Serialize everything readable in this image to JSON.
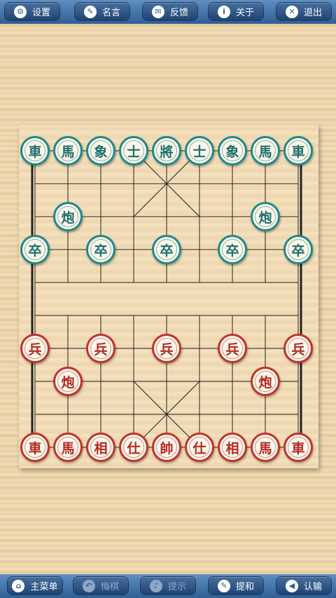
{
  "top_bar": {
    "buttons": [
      {
        "label": "设置",
        "icon": "gear-icon",
        "glyph": "⚙"
      },
      {
        "label": "名言",
        "icon": "speech-bubble-icon",
        "glyph": "✎"
      },
      {
        "label": "反馈",
        "icon": "mail-icon",
        "glyph": "✉"
      },
      {
        "label": "关于",
        "icon": "info-icon",
        "glyph": "i"
      },
      {
        "label": "退出",
        "icon": "close-icon",
        "glyph": "✕"
      }
    ]
  },
  "bottom_bar": {
    "buttons": [
      {
        "label": "主菜单",
        "icon": "home-icon",
        "glyph": "⌂",
        "enabled": true
      },
      {
        "label": "悔棋",
        "icon": "undo-icon",
        "glyph": "↶",
        "enabled": false
      },
      {
        "label": "提示",
        "icon": "bell-icon",
        "glyph": "♪",
        "enabled": false
      },
      {
        "label": "提和",
        "icon": "pen-icon",
        "glyph": "✎",
        "enabled": true
      },
      {
        "label": "认输",
        "icon": "flag-icon",
        "glyph": "◀",
        "enabled": true
      }
    ]
  },
  "board": {
    "files": 9,
    "ranks": 10,
    "pieces": [
      {
        "char": "車",
        "side": "black",
        "file": 0,
        "rank": 0
      },
      {
        "char": "馬",
        "side": "black",
        "file": 1,
        "rank": 0
      },
      {
        "char": "象",
        "side": "black",
        "file": 2,
        "rank": 0
      },
      {
        "char": "士",
        "side": "black",
        "file": 3,
        "rank": 0
      },
      {
        "char": "將",
        "side": "black",
        "file": 4,
        "rank": 0
      },
      {
        "char": "士",
        "side": "black",
        "file": 5,
        "rank": 0
      },
      {
        "char": "象",
        "side": "black",
        "file": 6,
        "rank": 0
      },
      {
        "char": "馬",
        "side": "black",
        "file": 7,
        "rank": 0
      },
      {
        "char": "車",
        "side": "black",
        "file": 8,
        "rank": 0
      },
      {
        "char": "炮",
        "side": "black",
        "file": 1,
        "rank": 2
      },
      {
        "char": "炮",
        "side": "black",
        "file": 7,
        "rank": 2
      },
      {
        "char": "卒",
        "side": "black",
        "file": 0,
        "rank": 3
      },
      {
        "char": "卒",
        "side": "black",
        "file": 2,
        "rank": 3
      },
      {
        "char": "卒",
        "side": "black",
        "file": 4,
        "rank": 3
      },
      {
        "char": "卒",
        "side": "black",
        "file": 6,
        "rank": 3
      },
      {
        "char": "卒",
        "side": "black",
        "file": 8,
        "rank": 3
      },
      {
        "char": "兵",
        "side": "red",
        "file": 0,
        "rank": 6
      },
      {
        "char": "兵",
        "side": "red",
        "file": 2,
        "rank": 6
      },
      {
        "char": "兵",
        "side": "red",
        "file": 4,
        "rank": 6
      },
      {
        "char": "兵",
        "side": "red",
        "file": 6,
        "rank": 6
      },
      {
        "char": "兵",
        "side": "red",
        "file": 8,
        "rank": 6
      },
      {
        "char": "炮",
        "side": "red",
        "file": 1,
        "rank": 7
      },
      {
        "char": "炮",
        "side": "red",
        "file": 7,
        "rank": 7
      },
      {
        "char": "車",
        "side": "red",
        "file": 0,
        "rank": 9
      },
      {
        "char": "馬",
        "side": "red",
        "file": 1,
        "rank": 9
      },
      {
        "char": "相",
        "side": "red",
        "file": 2,
        "rank": 9
      },
      {
        "char": "仕",
        "side": "red",
        "file": 3,
        "rank": 9
      },
      {
        "char": "帥",
        "side": "red",
        "file": 4,
        "rank": 9
      },
      {
        "char": "仕",
        "side": "red",
        "file": 5,
        "rank": 9
      },
      {
        "char": "相",
        "side": "red",
        "file": 6,
        "rank": 9
      },
      {
        "char": "馬",
        "side": "red",
        "file": 7,
        "rank": 9
      },
      {
        "char": "車",
        "side": "red",
        "file": 8,
        "rank": 9
      }
    ]
  }
}
